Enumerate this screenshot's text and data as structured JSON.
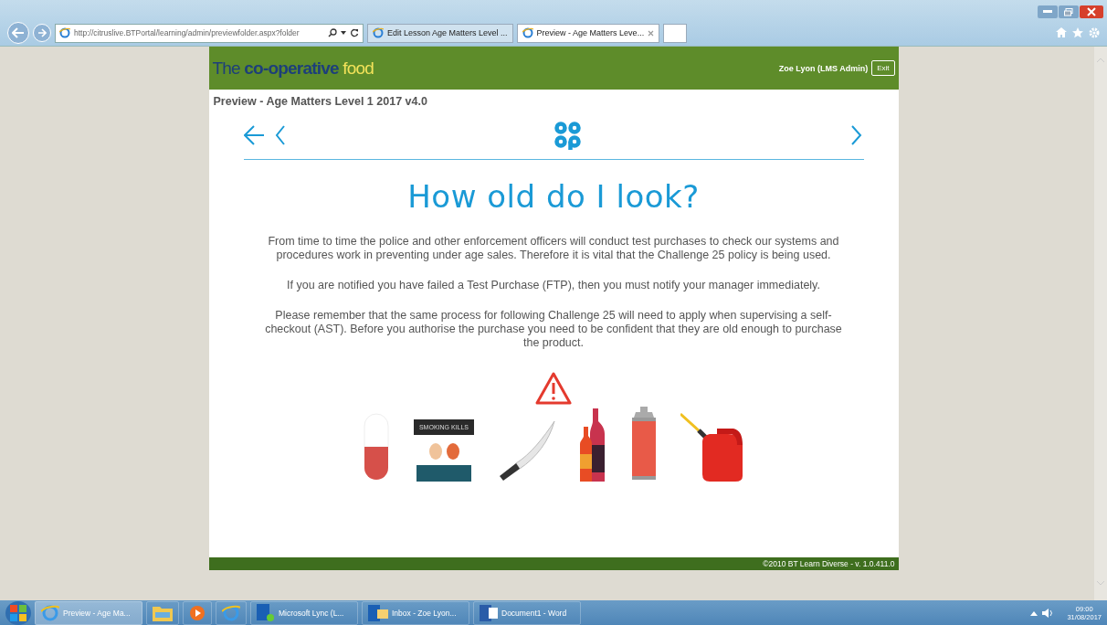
{
  "browser": {
    "url": "http://citruslive.BTPortal/learning/admin/previewfolder.aspx?folder",
    "tabs": [
      {
        "label": "Edit Lesson Age Matters Level ...",
        "selected": false
      },
      {
        "label": "Preview - Age Matters Leve...",
        "selected": true
      }
    ]
  },
  "header": {
    "brand_prefix": "The",
    "brand_name": "co-operative",
    "brand_suffix": "food",
    "user": "Zoe Lyon (LMS Admin)",
    "exit": "Exit"
  },
  "page_title": "Preview - Age Matters Level 1 2017 v4.0",
  "lesson": {
    "heading": "How old do I look?",
    "paragraphs": [
      "From time to time the police and other enforcement officers will conduct test purchases to check our systems and procedures work in preventing under age sales. Therefore it is vital that the Challenge 25 policy is being used.",
      "If you are notified you have failed a Test Purchase (FTP), then you must notify your manager immediately.",
      "Please remember that the same process for following Challenge 25 will need to apply when supervising a self-checkout (AST). Before you authorise the purchase you need to be confident that they are old enough to purchase the product."
    ],
    "products": [
      {
        "kind": "capsule"
      },
      {
        "kind": "cigarettes",
        "label": "SMOKING KILLS"
      },
      {
        "kind": "knife"
      },
      {
        "kind": "bottles"
      },
      {
        "kind": "aerosol"
      },
      {
        "kind": "fuel-can"
      }
    ]
  },
  "footer": "©2010 BT Learn Diverse - v. 1.0.411.0",
  "taskbar": {
    "items": [
      {
        "kind": "ie",
        "label": "Preview - Age Ma...",
        "selected": true
      },
      {
        "kind": "folder"
      },
      {
        "kind": "media"
      },
      {
        "kind": "ie"
      },
      {
        "kind": "lync",
        "label": "Microsoft Lync (L..."
      },
      {
        "kind": "outlook",
        "label": "Inbox - Zoe Lyon..."
      },
      {
        "kind": "word",
        "label": "Document1 - Word"
      }
    ],
    "time": "09:00",
    "date": "31/08/2017"
  }
}
